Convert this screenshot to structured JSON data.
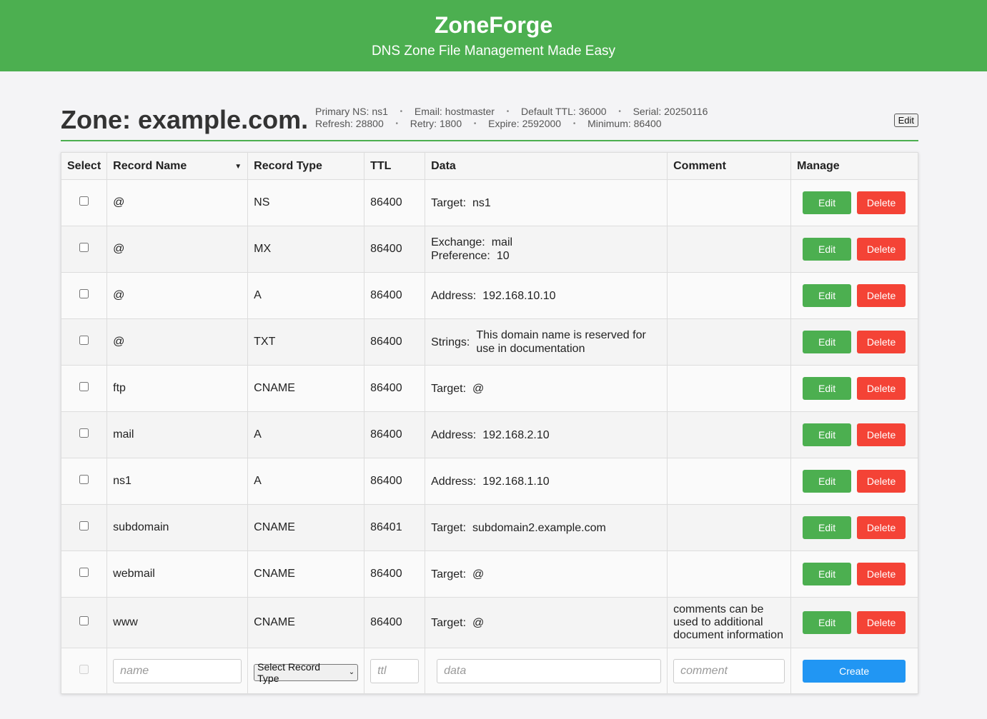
{
  "header": {
    "title": "ZoneForge",
    "subtitle": "DNS Zone File Management Made Easy"
  },
  "zone": {
    "title": "Zone: example.com.",
    "soa": {
      "primary_ns": "Primary NS: ns1",
      "email": "Email: hostmaster",
      "default_ttl": "Default TTL: 36000",
      "serial": "Serial: 20250116",
      "refresh": "Refresh: 28800",
      "retry": "Retry: 1800",
      "expire": "Expire: 2592000",
      "minimum": "Minimum: 86400",
      "separator": "•",
      "edit_label": "Edit"
    }
  },
  "table": {
    "columns": [
      "Select",
      "Record Name",
      "Record Type",
      "TTL",
      "Data",
      "Comment",
      "Manage"
    ],
    "sort_indicator": "▼",
    "edit_label": "Edit",
    "delete_label": "Delete",
    "records": [
      {
        "name": "@",
        "type": "NS",
        "ttl": "86400",
        "data": [
          {
            "key": "Target:",
            "value": "ns1"
          }
        ],
        "comment": ""
      },
      {
        "name": "@",
        "type": "MX",
        "ttl": "86400",
        "data": [
          {
            "key": "Exchange:",
            "value": "mail"
          },
          {
            "key": "Preference:",
            "value": "10"
          }
        ],
        "comment": ""
      },
      {
        "name": "@",
        "type": "A",
        "ttl": "86400",
        "data": [
          {
            "key": "Address:",
            "value": "192.168.10.10"
          }
        ],
        "comment": ""
      },
      {
        "name": "@",
        "type": "TXT",
        "ttl": "86400",
        "data": [
          {
            "key": "Strings:",
            "value": "This domain name is reserved for use in documentation"
          }
        ],
        "comment": ""
      },
      {
        "name": "ftp",
        "type": "CNAME",
        "ttl": "86400",
        "data": [
          {
            "key": "Target:",
            "value": "@"
          }
        ],
        "comment": ""
      },
      {
        "name": "mail",
        "type": "A",
        "ttl": "86400",
        "data": [
          {
            "key": "Address:",
            "value": "192.168.2.10"
          }
        ],
        "comment": ""
      },
      {
        "name": "ns1",
        "type": "A",
        "ttl": "86400",
        "data": [
          {
            "key": "Address:",
            "value": "192.168.1.10"
          }
        ],
        "comment": ""
      },
      {
        "name": "subdomain",
        "type": "CNAME",
        "ttl": "86401",
        "data": [
          {
            "key": "Target:",
            "value": "subdomain2.example.com"
          }
        ],
        "comment": ""
      },
      {
        "name": "webmail",
        "type": "CNAME",
        "ttl": "86400",
        "data": [
          {
            "key": "Target:",
            "value": "@"
          }
        ],
        "comment": ""
      },
      {
        "name": "www",
        "type": "CNAME",
        "ttl": "86400",
        "data": [
          {
            "key": "Target:",
            "value": "@"
          }
        ],
        "comment": "comments can be used to additional document information"
      }
    ],
    "create_row": {
      "name_placeholder": "name",
      "type_select_label": "Select Record Type",
      "ttl_placeholder": "ttl",
      "data_placeholder": "data",
      "comment_placeholder": "comment",
      "create_label": "Create"
    }
  },
  "colors": {
    "header_bg": "#4caf50",
    "edit_button": "#4caf50",
    "delete_button": "#f44336",
    "create_button": "#2196f3"
  }
}
